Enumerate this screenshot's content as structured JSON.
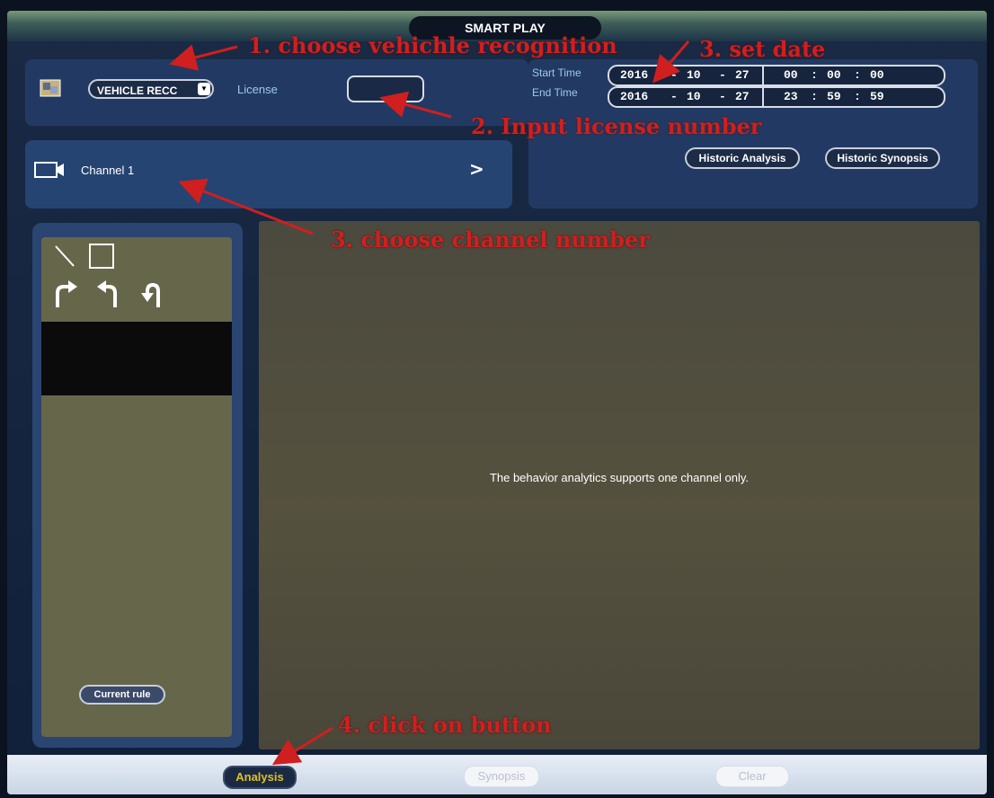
{
  "title": "SMART PLAY",
  "search": {
    "type_select": "VEHICLE RECC",
    "license_label": "License",
    "license_value": ""
  },
  "time": {
    "start_label": "Start Time",
    "end_label": "End Time",
    "start": {
      "year": "2016",
      "month": "10",
      "day": "27",
      "hh": "00",
      "mm": "00",
      "ss": "00"
    },
    "end": {
      "year": "2016",
      "month": "10",
      "day": "27",
      "hh": "23",
      "mm": "59",
      "ss": "59"
    },
    "date_sep": "-",
    "time_sep": ":"
  },
  "buttons": {
    "historic_analysis": "Historic Analysis",
    "historic_synopsis": "Historic Synopsis",
    "current_rule": "Current rule",
    "analysis": "Analysis",
    "synopsis": "Synopsis",
    "clear": "Clear"
  },
  "channel": {
    "label": "Channel 1",
    "chevron": ">"
  },
  "video": {
    "message": "The behavior analytics supports one channel only."
  },
  "annotations": {
    "a1": "1. choose vehichle recognition",
    "a2": "2. Input license number",
    "a3_date": "3. set date",
    "a3_channel": "3. choose channel number",
    "a4": "4. click on button"
  },
  "colors": {
    "annotation": "#d01f1f",
    "analysis_button": "#e0c21a"
  },
  "icons": [
    "search-type-icon",
    "camera-icon",
    "line-tool-icon",
    "rect-tool-icon",
    "turn-right-icon",
    "turn-left-icon",
    "u-turn-icon",
    "dropdown-arrow-icon"
  ]
}
